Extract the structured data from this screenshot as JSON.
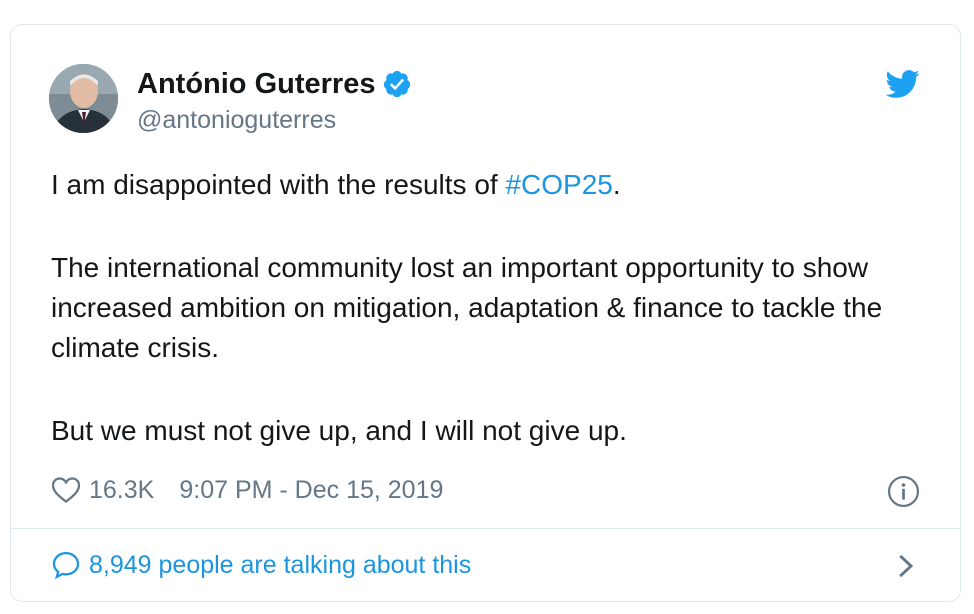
{
  "author": {
    "name": "António Guterres",
    "handle": "@antonioguterres",
    "verified": true,
    "avatar": "portrait-photo"
  },
  "icons": {
    "brand": "twitter-bird-icon",
    "like": "heart-icon",
    "info": "info-icon",
    "conversation": "speech-bubble-icon",
    "more": "chevron-right-icon"
  },
  "tweet": {
    "line1_prefix": "I am disappointed with the results of ",
    "hashtag": "#COP25",
    "line1_suffix": ".",
    "paragraph2": "The international community lost an important opportunity to show increased ambition on mitigation, adaptation & finance to tackle the climate crisis.",
    "paragraph3": "But we must not give up, and I will not give up."
  },
  "meta": {
    "likes": "16.3K",
    "timestamp": "9:07 PM - Dec 15, 2019"
  },
  "footer": {
    "talking": "8,949 people are talking about this"
  },
  "colors": {
    "link": "#1b95e0",
    "secondary_text": "#657786",
    "primary_text": "#14171a",
    "border": "#e1e8ed"
  }
}
